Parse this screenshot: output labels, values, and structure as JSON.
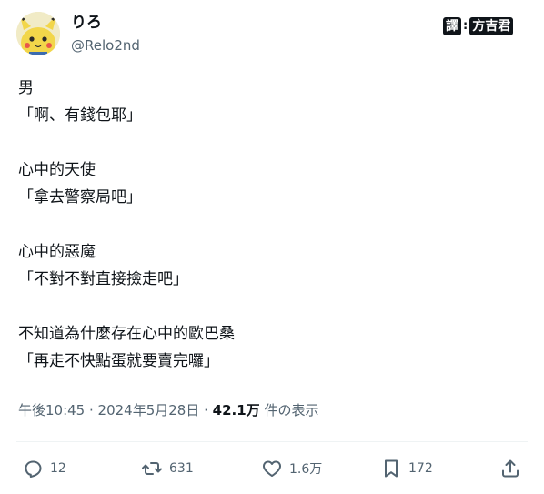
{
  "author": {
    "name": "りろ",
    "handle": "@Relo2nd"
  },
  "badge": {
    "left": "譯",
    "colon": ":",
    "right": "方吉君"
  },
  "body": [
    {
      "lines": [
        "男",
        "「啊、有錢包耶」"
      ]
    },
    {
      "lines": [
        "心中的天使",
        "「拿去警察局吧」"
      ]
    },
    {
      "lines": [
        "心中的惡魔",
        "「不對不對直接撿走吧」"
      ]
    },
    {
      "lines": [
        "不知道為什麼存在心中的歐巴桑",
        "「再走不快點蛋就要賣完囉」"
      ]
    }
  ],
  "meta": {
    "time": "午後10:45",
    "sep1": " · ",
    "date": "2024年5月28日",
    "sep2": " · ",
    "views_count": "42.1万",
    "views_label": " 件の表示"
  },
  "actions": {
    "reply": {
      "icon": "reply-icon",
      "count": "12"
    },
    "retweet": {
      "icon": "retweet-icon",
      "count": "631"
    },
    "like": {
      "icon": "heart-icon",
      "count": "1.6万"
    },
    "bookmark": {
      "icon": "bookmark-icon",
      "count": "172"
    },
    "share": {
      "icon": "share-icon"
    }
  }
}
